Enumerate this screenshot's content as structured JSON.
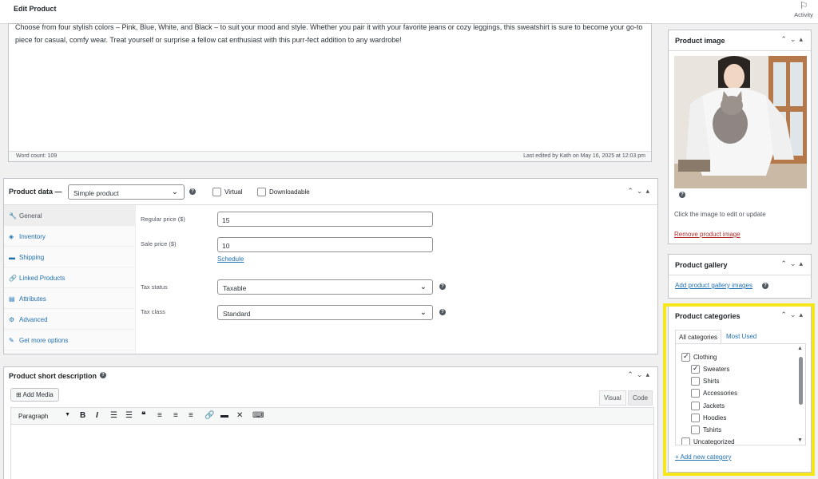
{
  "topbar": {
    "title": "Edit Product",
    "activity_label": "Activity",
    "activity_icon": "flag-icon"
  },
  "editor": {
    "text": "Choose from four stylish colors – Pink, Blue, White, and Black – to suit your mood and style. Whether you pair it with your favorite jeans or cozy leggings, this sweatshirt is sure to become your go-to piece for casual, comfy wear. Treat yourself or surprise a fellow cat enthusiast with this purr-fect addition to any wardrobe!",
    "word_count": "Word count: 109",
    "last_edited": "Last edited by Kath on May 16, 2025 at 12:03 pm"
  },
  "product_data": {
    "label": "Product data —",
    "type_value": "Simple product",
    "virtual_label": "Virtual",
    "downloadable_label": "Downloadable",
    "tabs": [
      {
        "label": "General",
        "icon": "wrench-icon",
        "glyph": "🔧"
      },
      {
        "label": "Inventory",
        "icon": "tag-icon",
        "glyph": "◈"
      },
      {
        "label": "Shipping",
        "icon": "truck-icon",
        "glyph": "▬"
      },
      {
        "label": "Linked Products",
        "icon": "link-icon",
        "glyph": "🔗"
      },
      {
        "label": "Attributes",
        "icon": "list-icon",
        "glyph": "▤"
      },
      {
        "label": "Advanced",
        "icon": "gear-icon",
        "glyph": "⚙"
      },
      {
        "label": "Get more options",
        "icon": "plugin-icon",
        "glyph": "✎"
      }
    ],
    "regular_price_label": "Regular price ($)",
    "regular_price_value": "15",
    "sale_price_label": "Sale price ($)",
    "sale_price_value": "10",
    "schedule_label": "Schedule",
    "tax_status_label": "Tax status",
    "tax_status_value": "Taxable",
    "tax_class_label": "Tax class",
    "tax_class_value": "Standard"
  },
  "short_description": {
    "label": "Product short description",
    "add_media_label": "Add Media",
    "visual_label": "Visual",
    "code_label": "Code",
    "paragraph_label": "Paragraph"
  },
  "product_image": {
    "label": "Product image",
    "note": "Click the image to edit or update",
    "remove_label": "Remove product image"
  },
  "product_gallery": {
    "label": "Product gallery",
    "add_label": "Add product gallery images"
  },
  "product_categories": {
    "label": "Product categories",
    "tab_all": "All categories",
    "tab_most_used": "Most Used",
    "items": [
      {
        "name": "Clothing",
        "checked": true,
        "indent": 0
      },
      {
        "name": "Sweaters",
        "checked": true,
        "indent": 1
      },
      {
        "name": "Shirts",
        "checked": false,
        "indent": 1
      },
      {
        "name": "Accessories",
        "checked": false,
        "indent": 1
      },
      {
        "name": "Jackets",
        "checked": false,
        "indent": 1
      },
      {
        "name": "Hoodies",
        "checked": false,
        "indent": 1
      },
      {
        "name": "Tshirts",
        "checked": false,
        "indent": 1
      },
      {
        "name": "Uncategorized",
        "checked": false,
        "indent": 0
      }
    ],
    "add_new_label": "+ Add new category"
  },
  "colors": {
    "link": "#2271b1",
    "danger": "#b32d2e",
    "highlight": "#f5e61e"
  }
}
